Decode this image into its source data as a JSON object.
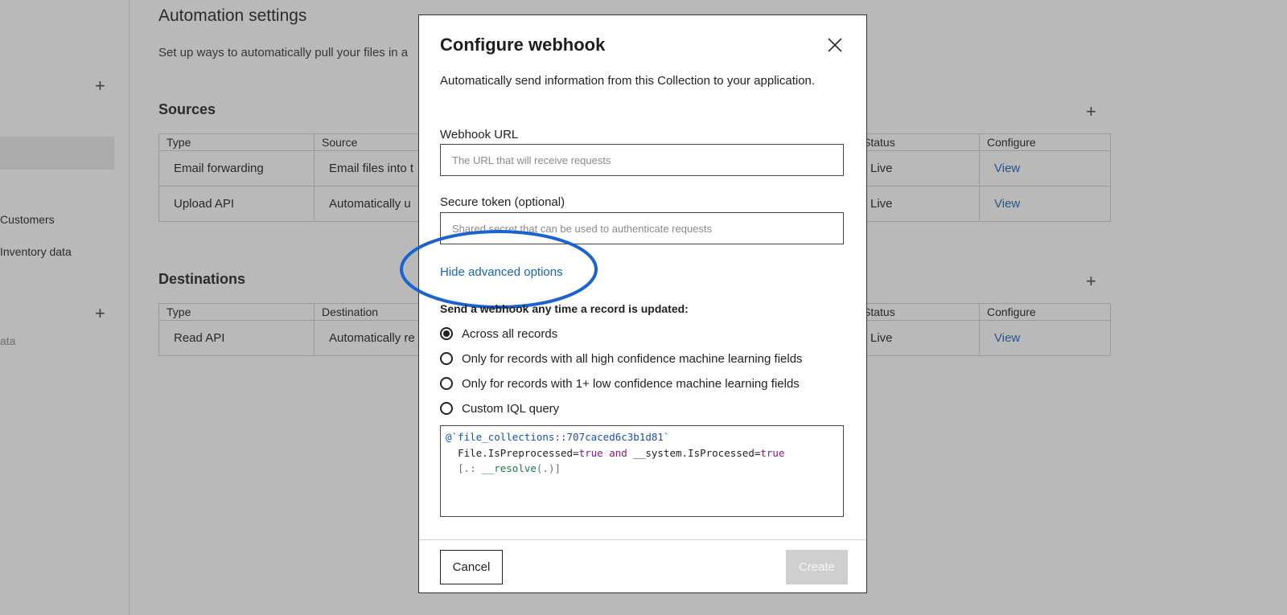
{
  "background": {
    "page_title": "Automation settings",
    "page_description": "Set up ways to automatically pull your files in a",
    "sidebar": {
      "items": [
        "Customers",
        "Inventory data",
        "ata"
      ]
    },
    "sources": {
      "title": "Sources",
      "columns": [
        "Type",
        "Source",
        "Status",
        "Configure"
      ],
      "rows": [
        {
          "type": "Email forwarding",
          "source": "Email files into t",
          "status": "Live",
          "configure": "View"
        },
        {
          "type": "Upload API",
          "source": "Automatically u",
          "status": "Live",
          "configure": "View"
        }
      ]
    },
    "destinations": {
      "title": "Destinations",
      "columns": [
        "Type",
        "Destination",
        "Status",
        "Configure"
      ],
      "rows": [
        {
          "type": "Read API",
          "destination": "Automatically re",
          "status": "Live",
          "configure": "View"
        }
      ]
    }
  },
  "modal": {
    "title": "Configure webhook",
    "description": "Automatically send information from this Collection to your application.",
    "webhook_url": {
      "label": "Webhook URL",
      "placeholder": "The URL that will receive requests",
      "value": ""
    },
    "secure_token": {
      "label": "Secure token (optional)",
      "placeholder": "Shared secret that can be used to authenticate requests",
      "value": ""
    },
    "advanced_link": "Hide advanced options",
    "send_label": "Send a webhook any time a record is updated:",
    "radio_options": [
      {
        "label": "Across all records",
        "selected": true
      },
      {
        "label": "Only for records with all high confidence machine learning fields",
        "selected": false
      },
      {
        "label": "Only for records with 1+ low confidence machine learning fields",
        "selected": false
      },
      {
        "label": "Custom IQL query",
        "selected": false
      }
    ],
    "query": {
      "line1": "@`file_collections::707caced6c3b1d81`",
      "line2_a": "File.IsPreprocessed=",
      "line2_b": "true",
      "line2_c": " and ",
      "line2_d": "__system.IsProcessed=",
      "line2_e": "true",
      "line3_a": "[.: ",
      "line3_b": "__resolve",
      "line3_c": "(.)]"
    },
    "cancel_label": "Cancel",
    "create_label": "Create"
  },
  "colors": {
    "link": "#1565c0",
    "highlight_ellipse": "#1a63d1",
    "create_disabled_bg": "#cfcfcf"
  },
  "icons": [
    "close-icon",
    "plus-icon"
  ]
}
